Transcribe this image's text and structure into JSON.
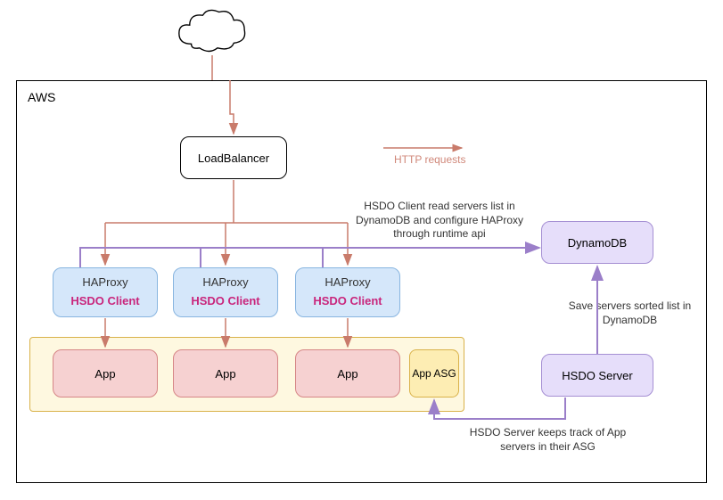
{
  "container": {
    "label": "AWS"
  },
  "loadbalancer": {
    "label": "LoadBalancer"
  },
  "legend": {
    "label": "HTTP requests"
  },
  "haproxy": {
    "label": "HAProxy",
    "client_label": "HSDO Client"
  },
  "app": {
    "label": "App"
  },
  "app_asg": {
    "label": "App ASG"
  },
  "dynamodb": {
    "label": "DynamoDB"
  },
  "hsdo_server": {
    "label": "HSDO Server"
  },
  "annotations": {
    "client_read": "HSDO Client read servers list in DynamoDB and configure HAProxy through runtime api",
    "save_servers": "Save servers sorted list in DynamoDB",
    "hsdo_server": "HSDO Server keeps track of App servers in their ASG"
  },
  "colors": {
    "http": "#c97b6b",
    "purple": "#9b7fc9",
    "haproxy_bg": "#d5e7fa",
    "app_bg": "#f6d1d1",
    "asg_bg": "#fef8e0",
    "purple_bg": "#e6defa"
  }
}
